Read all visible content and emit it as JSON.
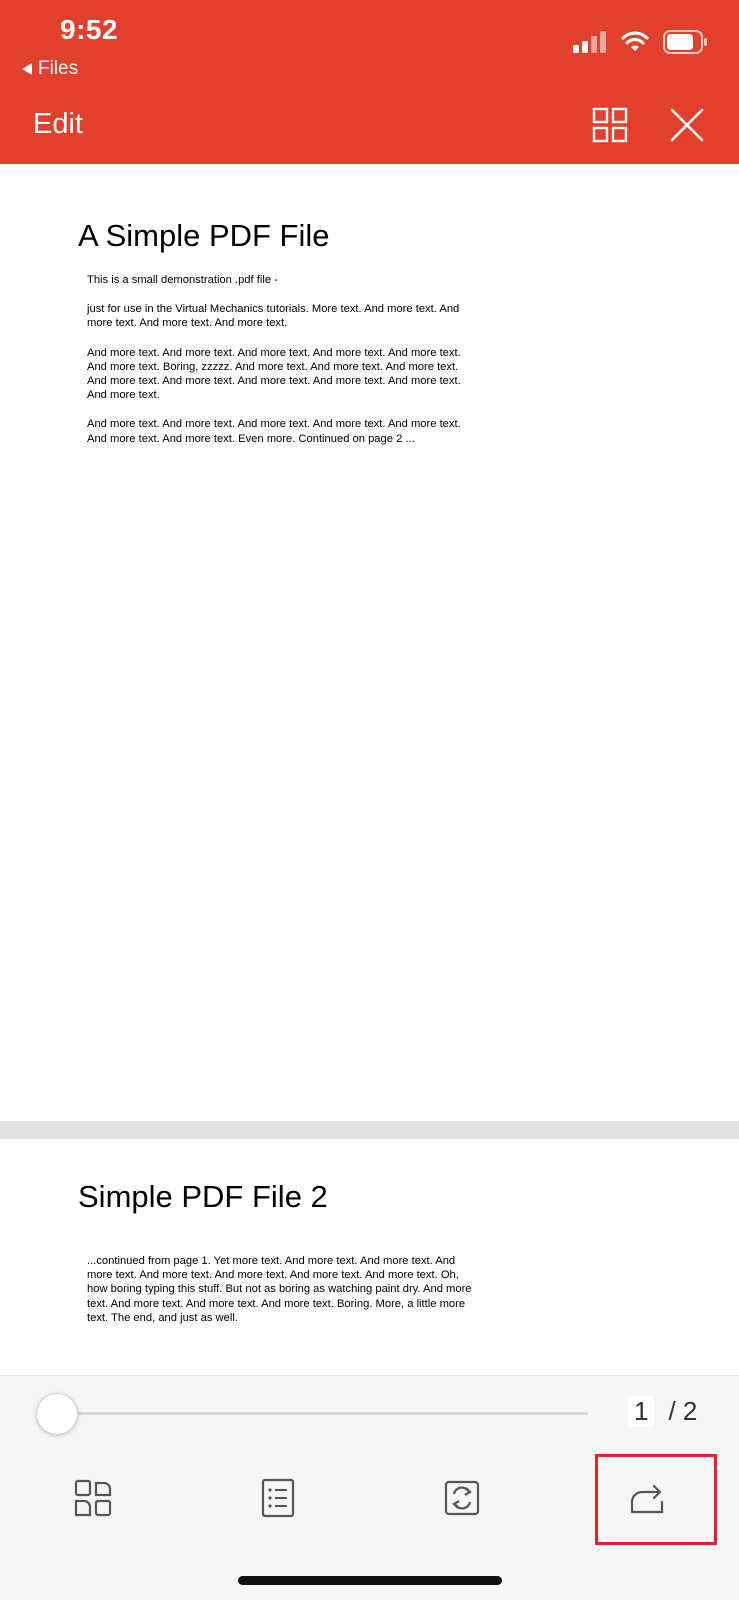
{
  "status_bar": {
    "time": "9:52",
    "back_label": "Files"
  },
  "header": {
    "edit_label": "Edit",
    "grid_icon": "grid-view-icon",
    "close_icon": "close-icon",
    "color": "#e1402c"
  },
  "document": {
    "page1": {
      "title": "A Simple PDF File",
      "paragraphs": [
        "This is a small demonstration .pdf file -",
        "just for use in the Virtual Mechanics tutorials. More text. And more text. And more text. And more text. And more text.",
        "And more text. And more text. And more text. And more text. And more text. And more text. Boring, zzzzz. And more text. And more text. And more text. And more text. And more text. And more text. And more text. And more text. And more text.",
        "And more text. And more text. And more text. And more text. And more text. And more text. And more text. Even more. Continued on page 2 ..."
      ]
    },
    "page2": {
      "title": "Simple PDF File 2",
      "paragraphs": [
        "...continued from page 1. Yet more text. And more text. And more text. And more text. And more text. And more text. And more text. And more text. Oh, how boring typing this stuff. But not as boring as watching paint dry. And more text. And more text. And more text. And more text. Boring.  More, a little more text. The end, and just as well."
      ]
    }
  },
  "pager": {
    "current": "1",
    "separator": "/ 2",
    "progress": 0
  },
  "toolbar": {
    "tools": [
      "thumbnails-icon",
      "outline-list-icon",
      "convert-icon",
      "share-icon"
    ],
    "highlight_color": "#e0232a"
  }
}
